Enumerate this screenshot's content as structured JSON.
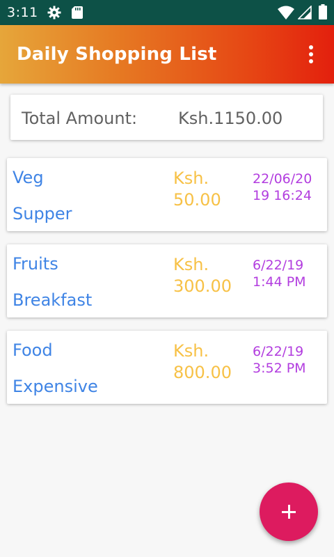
{
  "status_bar": {
    "time": "3:11",
    "icons": [
      "gear-icon",
      "sd-card-icon",
      "wifi-icon",
      "signal-icon",
      "battery-icon"
    ]
  },
  "app_bar": {
    "title": "Daily Shopping List",
    "menu_icon": "overflow-menu-icon"
  },
  "total": {
    "label": "Total Amount:",
    "value": "Ksh.1150.00"
  },
  "items": [
    {
      "name": "Veg",
      "category": "Supper",
      "currency": "Ksh.",
      "amount": "50.00",
      "date": "22/06/2019 16:24"
    },
    {
      "name": "Fruits",
      "category": "Breakfast",
      "currency": "Ksh.",
      "amount": "300.00",
      "date": "6/22/19 1:44 PM"
    },
    {
      "name": "Food",
      "category": "Expensive",
      "currency": "Ksh.",
      "amount": "800.00",
      "date": "6/22/19 3:52 PM"
    }
  ],
  "fab": {
    "icon": "plus-icon"
  },
  "colors": {
    "status_bar": "#0d5147",
    "name_text": "#3f84e5",
    "amount_text": "#f7c146",
    "date_text": "#b23ddf",
    "fab": "#dd1b5f"
  }
}
